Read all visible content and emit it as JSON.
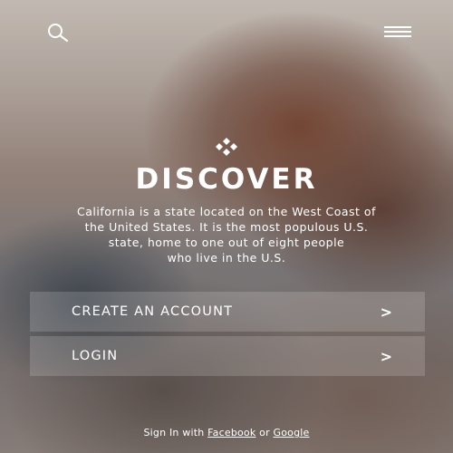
{
  "header": {
    "search_icon": "search-icon",
    "menu_icon": "hamburger-menu-icon"
  },
  "hero": {
    "logo_icon": "diamond-logo-icon",
    "title": "DISCOVER",
    "description_lines": [
      "California is a state located on the West Coast of",
      "the United States. It is the most populous U.S.",
      "state, home to one out of eight people",
      "who live in the U.S."
    ]
  },
  "actions": [
    {
      "label": "CREATE AN ACCOUNT",
      "chevron": ">"
    },
    {
      "label": "LOGIN",
      "chevron": ">"
    }
  ],
  "footer": {
    "prefix": "Sign In with",
    "facebook": "Facebook",
    "or": "or",
    "google": "Google"
  }
}
